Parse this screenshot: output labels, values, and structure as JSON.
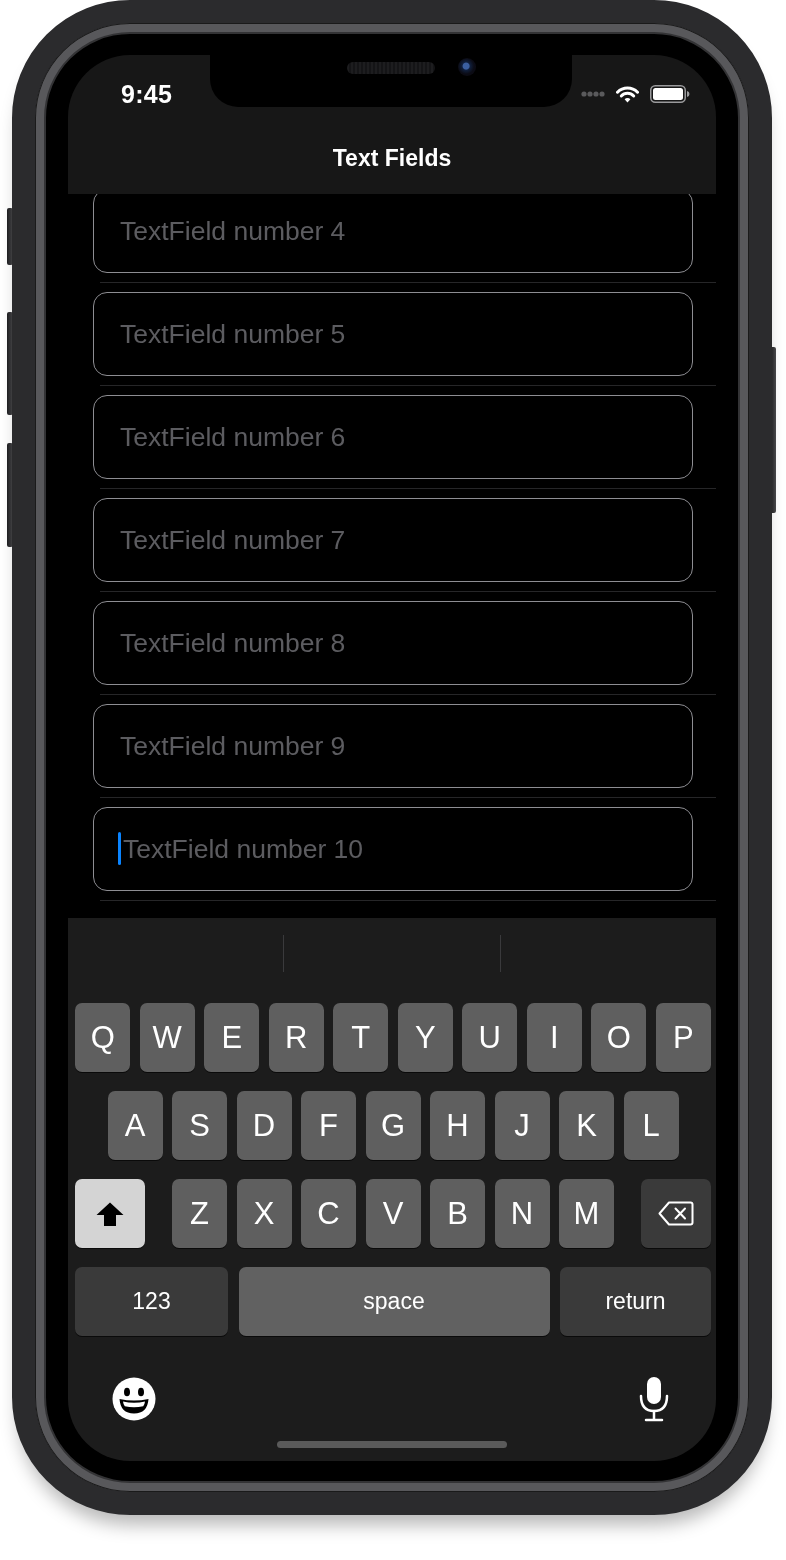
{
  "status_bar": {
    "time": "9:45"
  },
  "navigation_bar": {
    "title": "Text Fields"
  },
  "text_fields": [
    {
      "placeholder": "TextField number 4",
      "focused": false
    },
    {
      "placeholder": "TextField number 5",
      "focused": false
    },
    {
      "placeholder": "TextField number 6",
      "focused": false
    },
    {
      "placeholder": "TextField number 7",
      "focused": false
    },
    {
      "placeholder": "TextField number 8",
      "focused": false
    },
    {
      "placeholder": "TextField number 9",
      "focused": false
    },
    {
      "placeholder": "TextField number 10",
      "focused": true
    }
  ],
  "keyboard": {
    "shift_on": true,
    "rows": [
      {
        "keys": [
          {
            "kind": "letter",
            "label": "Q"
          },
          {
            "kind": "letter",
            "label": "W"
          },
          {
            "kind": "letter",
            "label": "E"
          },
          {
            "kind": "letter",
            "label": "R"
          },
          {
            "kind": "letter",
            "label": "T"
          },
          {
            "kind": "letter",
            "label": "Y"
          },
          {
            "kind": "letter",
            "label": "U"
          },
          {
            "kind": "letter",
            "label": "I"
          },
          {
            "kind": "letter",
            "label": "O"
          },
          {
            "kind": "letter",
            "label": "P"
          }
        ]
      },
      {
        "keys": [
          {
            "kind": "letter",
            "label": "A"
          },
          {
            "kind": "letter",
            "label": "S"
          },
          {
            "kind": "letter",
            "label": "D"
          },
          {
            "kind": "letter",
            "label": "F"
          },
          {
            "kind": "letter",
            "label": "G"
          },
          {
            "kind": "letter",
            "label": "H"
          },
          {
            "kind": "letter",
            "label": "J"
          },
          {
            "kind": "letter",
            "label": "K"
          },
          {
            "kind": "letter",
            "label": "L"
          }
        ]
      },
      {
        "keys": [
          {
            "kind": "shift"
          },
          {
            "kind": "letter",
            "label": "Z"
          },
          {
            "kind": "letter",
            "label": "X"
          },
          {
            "kind": "letter",
            "label": "C"
          },
          {
            "kind": "letter",
            "label": "V"
          },
          {
            "kind": "letter",
            "label": "B"
          },
          {
            "kind": "letter",
            "label": "N"
          },
          {
            "kind": "letter",
            "label": "M"
          },
          {
            "kind": "backspace"
          }
        ]
      },
      {
        "keys": [
          {
            "kind": "mode",
            "label": "123"
          },
          {
            "kind": "space",
            "label": "space"
          },
          {
            "kind": "return",
            "label": "return"
          }
        ]
      }
    ]
  }
}
